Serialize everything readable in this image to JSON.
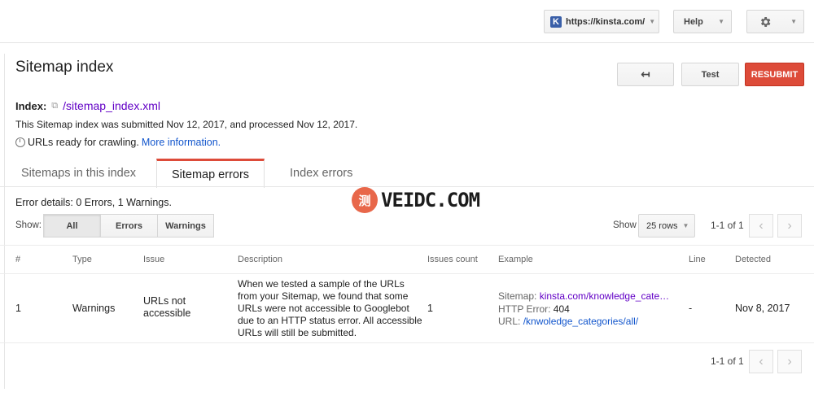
{
  "topbar": {
    "site_badge": "K",
    "site_url": "https://kinsta.com/",
    "help_label": "Help",
    "settings_icon": "gear-icon"
  },
  "header": {
    "title": "Sitemap index",
    "back_icon": "back-arrow-icon",
    "test_label": "Test",
    "resubmit_label": "RESUBMIT"
  },
  "index": {
    "label": "Index:",
    "link": "/sitemap_index.xml",
    "submitted_text": "This Sitemap index was submitted Nov 12, 2017, and processed Nov 12, 2017.",
    "status_text": "URLs ready for crawling.",
    "more_info": "More information."
  },
  "tabs": [
    "Sitemaps in this index",
    "Sitemap errors",
    "Index errors"
  ],
  "active_tab": 1,
  "filters": {
    "error_details": "Error details: 0 Errors, 1 Warnings.",
    "show_label": "Show:",
    "options": [
      "All",
      "Errors",
      "Warnings"
    ],
    "selected": "All",
    "rows_label": "Show",
    "rows_value": "25 rows",
    "pager_text": "1-1 of 1"
  },
  "table": {
    "headers": [
      "#",
      "Type",
      "Issue",
      "Description",
      "Issues count",
      "Example",
      "Line",
      "Detected"
    ],
    "rows": [
      {
        "num": "1",
        "type": "Warnings",
        "issue": "URLs not accessible",
        "description": "When we tested a sample of the URLs from your Sitemap, we found that some URLs were not accessible to Googlebot due to an HTTP status error. All accessible URLs will still be submitted.",
        "issues_count": "1",
        "example": {
          "sitemap_label": "Sitemap:",
          "sitemap_link": "kinsta.com/knowledge_cate…",
          "http_label": "HTTP Error:",
          "http_value": "404",
          "url_label": "URL:",
          "url_link": "/knwoledge_categories/all/"
        },
        "line": "-",
        "detected": "Nov 8, 2017"
      }
    ]
  },
  "footer_pager": "1-1 of 1",
  "watermark": {
    "badge": "测",
    "text": "VEIDC.COM"
  },
  "colors": {
    "accent_red": "#dd4b39",
    "link_blue": "#1155cc",
    "link_purple": "#6200c6"
  }
}
